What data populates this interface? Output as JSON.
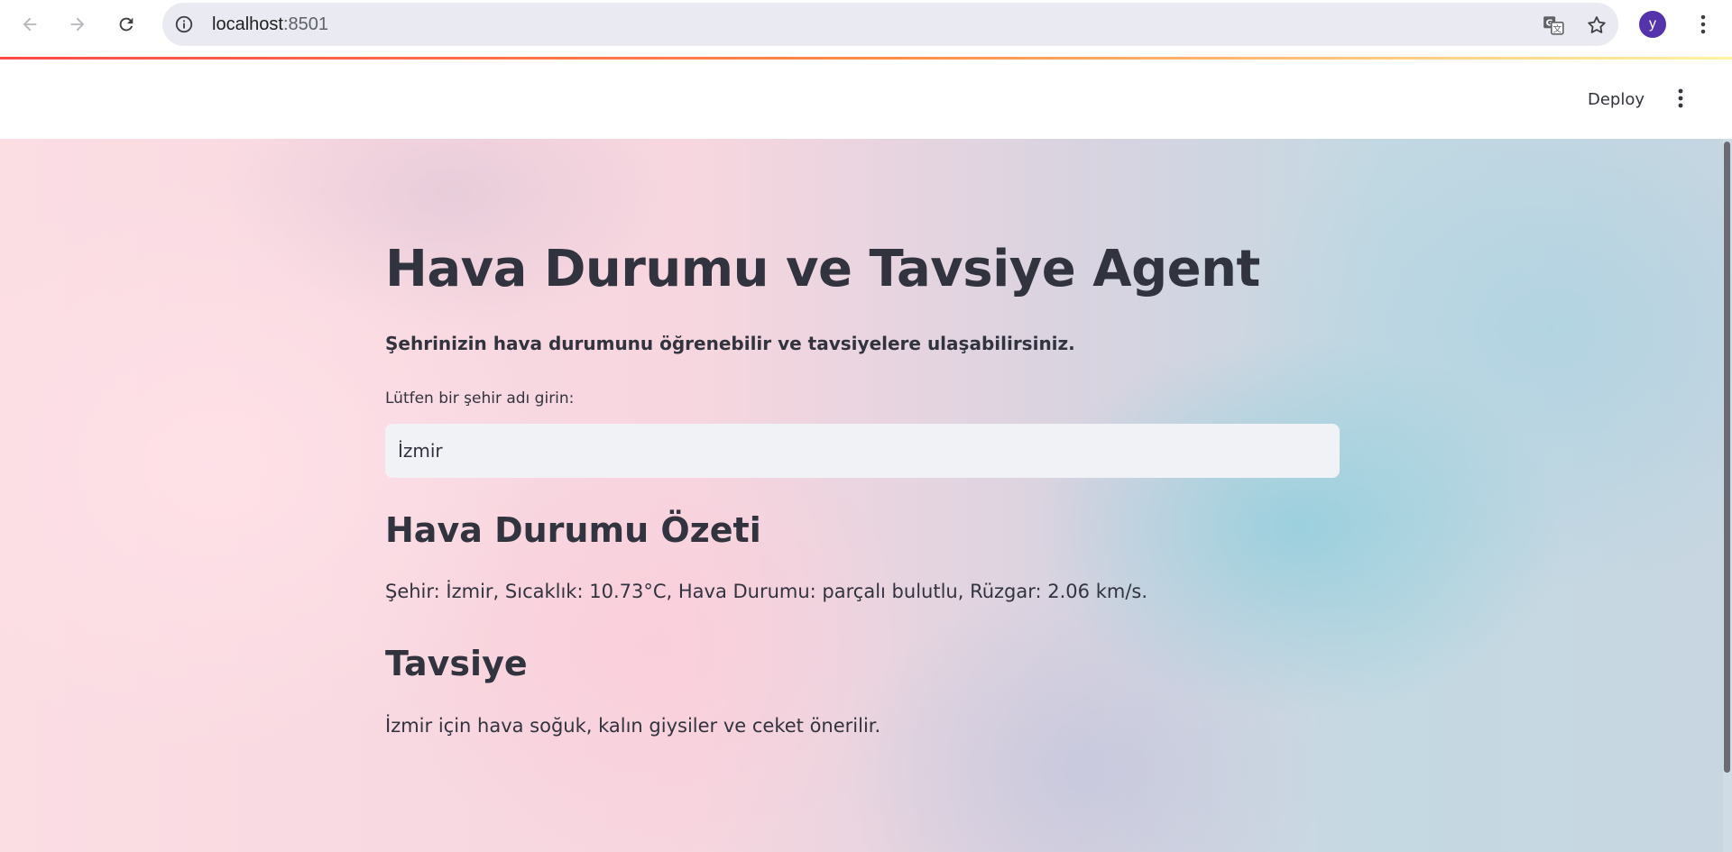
{
  "browser": {
    "url_host": "localhost",
    "url_port": ":8501",
    "avatar_letter": "y",
    "icons": {
      "back": "arrow-left-icon",
      "forward": "arrow-right-icon",
      "reload": "reload-icon",
      "site_info": "info-icon",
      "translate": "translate-icon",
      "bookmark": "star-icon",
      "menu": "kebab-icon"
    }
  },
  "header": {
    "deploy_label": "Deploy",
    "menu_icon": "kebab-icon"
  },
  "main": {
    "title": "Hava Durumu ve Tavsiye Agent",
    "subtitle": "Şehrinizin hava durumunu öğrenebilir ve tavsiyelere ulaşabilirsiniz.",
    "city_input": {
      "label": "Lütfen bir şehir adı girin:",
      "value": "İzmir",
      "placeholder": ""
    },
    "summary": {
      "heading": "Hava Durumu Özeti",
      "text": "Şehir: İzmir, Sıcaklık: 10.73°C, Hava Durumu: parçalı bulutlu, Rüzgar: 2.06 km/s."
    },
    "advice": {
      "heading": "Tavsiye",
      "text": "İzmir için hava soğuk, kalın giysiler ve ceket önerilir."
    }
  },
  "colors": {
    "text": "#31333f",
    "input_bg": "#f0f2f6",
    "avatar": "#5533aa",
    "accent_red": "#ff4b4b"
  }
}
